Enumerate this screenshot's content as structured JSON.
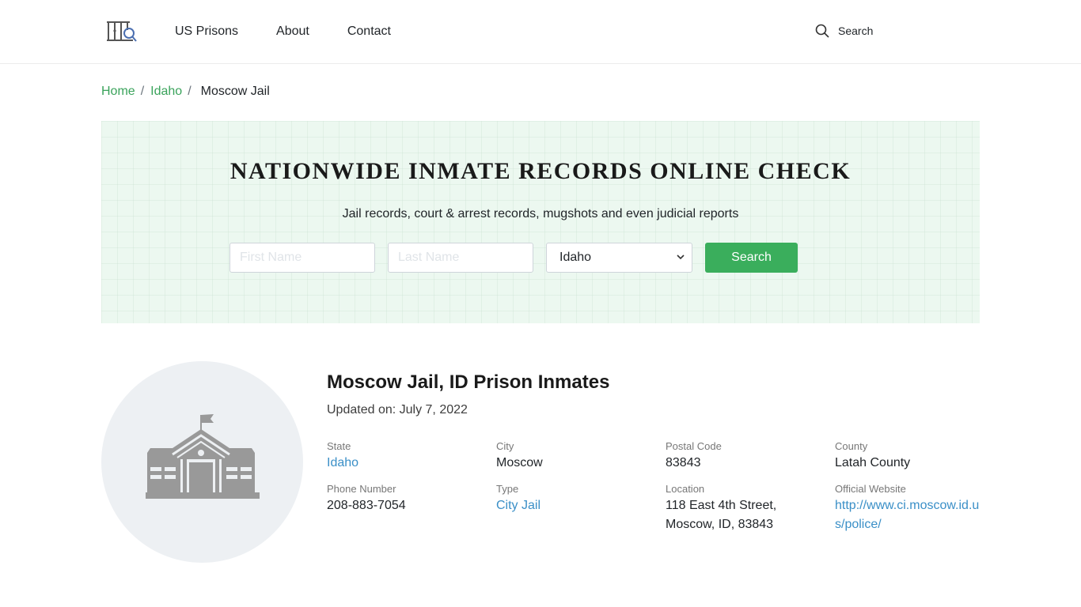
{
  "header": {
    "logo_icon": "jail-bars-magnifier-icon",
    "nav": [
      {
        "label": "US Prisons"
      },
      {
        "label": "About"
      },
      {
        "label": "Contact"
      }
    ],
    "search_icon": "search-icon",
    "search_label": "Search"
  },
  "breadcrumb": {
    "items": [
      {
        "label": "Home"
      },
      {
        "label": "Idaho"
      }
    ],
    "separator": "/",
    "current": "Moscow Jail"
  },
  "banner": {
    "title": "NATIONWIDE INMATE RECORDS ONLINE CHECK",
    "subtitle": "Jail records, court & arrest records, mugshots and even judicial reports",
    "first_name_placeholder": "First Name",
    "last_name_placeholder": "Last Name",
    "state_selected": "Idaho",
    "search_button": "Search"
  },
  "facility": {
    "image_icon": "government-building-icon",
    "title": "Moscow Jail, ID Prison Inmates",
    "updated": "Updated on: July 7, 2022",
    "fields": [
      {
        "label": "State",
        "value": "Idaho",
        "link": true
      },
      {
        "label": "City",
        "value": "Moscow",
        "link": false
      },
      {
        "label": "Postal Code",
        "value": "83843",
        "link": false
      },
      {
        "label": "County",
        "value": "Latah County",
        "link": false
      },
      {
        "label": "Phone Number",
        "value": "208-883-7054",
        "link": false
      },
      {
        "label": "Type",
        "value": "City Jail",
        "link": true
      },
      {
        "label": "Location",
        "value": "118 East 4th Street, Moscow, ID, 83843",
        "link": false
      },
      {
        "label": "Official Website",
        "value": "http://www.ci.moscow.id.us/police/",
        "link": true
      }
    ]
  },
  "colors": {
    "accent_green": "#3aae5c",
    "link_blue": "#3a8fc7",
    "banner_bg": "#ecf8f0"
  }
}
